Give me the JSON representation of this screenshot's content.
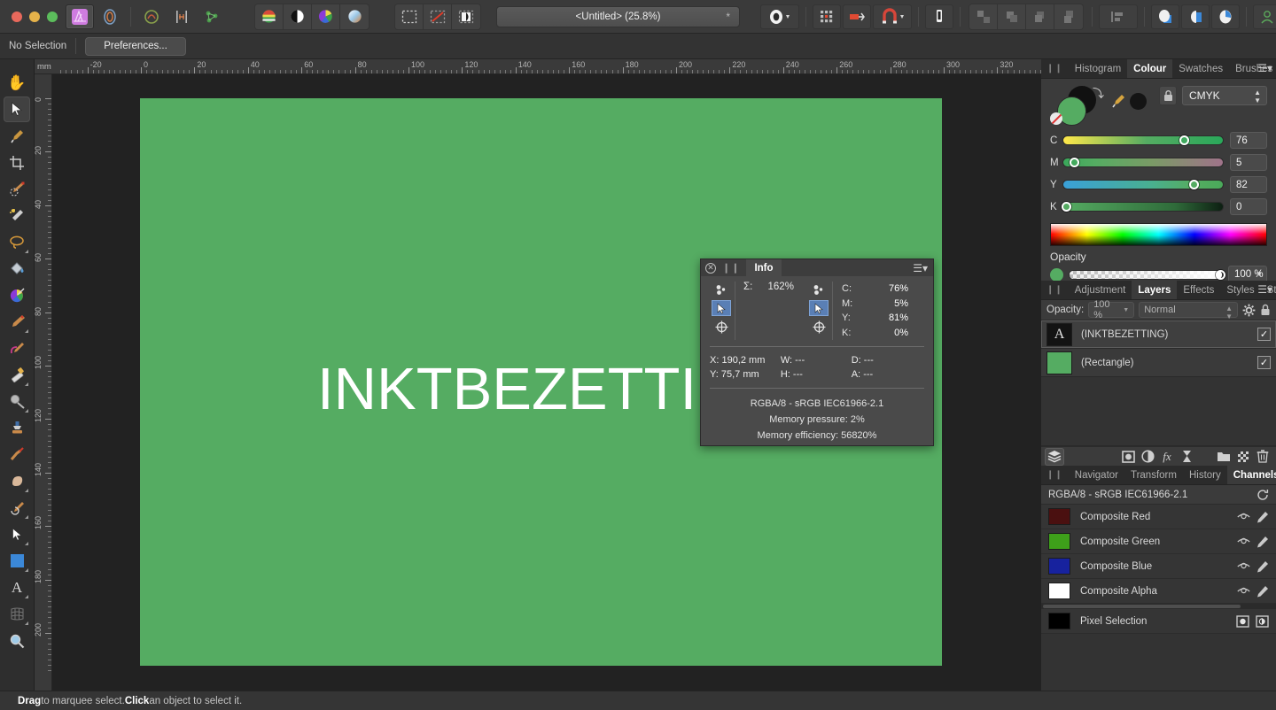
{
  "app": {
    "name": "Affinity Photo",
    "document_title": "<Untitled> (25.8%)",
    "modified_marker": "*"
  },
  "context_bar": {
    "selection_label": "No Selection",
    "preferences_label": "Preferences..."
  },
  "toolbar": {
    "window_controls": [
      "close",
      "minimize",
      "zoom"
    ],
    "persona_icons": [
      "affinity-logo-icon",
      "photo-persona-icon",
      "liquify-persona-icon",
      "develop-persona-icon",
      "tone-mapping-persona-icon",
      "export-persona-icon"
    ],
    "view_icons": [
      "colour-format-icon",
      "black-white-proof-icon",
      "colour-wheel-icon",
      "gradient-proof-icon"
    ],
    "selection_icons": [
      "marquee-select-icon",
      "deselect-icon",
      "refine-selection-icon"
    ],
    "right_icons": [
      "assistant-icon",
      "grid-icon",
      "snapping-icon",
      "magnet-icon",
      "pixel-align-icon",
      "arrange-front-icon",
      "arrange-forward-icon",
      "arrange-backward-icon",
      "arrange-back-icon",
      "align-icon",
      "blend-a-icon",
      "blend-b-icon",
      "blend-c-icon",
      "account-icon"
    ]
  },
  "tools": [
    {
      "name": "view-tool",
      "icon": "hand-icon",
      "selected": false,
      "has_flyout": false
    },
    {
      "name": "move-tool",
      "icon": "arrow-cursor-icon",
      "selected": true,
      "has_flyout": false
    },
    {
      "name": "colour-picker-tool",
      "icon": "eyedropper-icon",
      "selected": false,
      "has_flyout": false
    },
    {
      "name": "crop-tool",
      "icon": "crop-icon",
      "selected": false,
      "has_flyout": false
    },
    {
      "name": "selection-brush-tool",
      "icon": "selection-brush-icon",
      "selected": false,
      "has_flyout": false
    },
    {
      "name": "flood-select-tool",
      "icon": "magic-wand-icon",
      "selected": false,
      "has_flyout": false
    },
    {
      "name": "freehand-selection-tool",
      "icon": "lasso-icon",
      "selected": false,
      "has_flyout": true
    },
    {
      "name": "flood-fill-tool",
      "icon": "paint-bucket-icon",
      "selected": false,
      "has_flyout": false
    },
    {
      "name": "paint-mixer-tool",
      "icon": "colour-wheel-mixer-icon",
      "selected": false,
      "has_flyout": false
    },
    {
      "name": "paint-brush-tool",
      "icon": "paint-brush-icon",
      "selected": false,
      "has_flyout": true
    },
    {
      "name": "colour-replacement-tool",
      "icon": "colour-replace-brush-icon",
      "selected": false,
      "has_flyout": false
    },
    {
      "name": "erase-brush-tool",
      "icon": "eraser-icon",
      "selected": false,
      "has_flyout": true
    },
    {
      "name": "dodge-tool",
      "icon": "dodge-icon",
      "selected": false,
      "has_flyout": true
    },
    {
      "name": "clone-brush-tool",
      "icon": "clone-stamp-icon",
      "selected": false,
      "has_flyout": false
    },
    {
      "name": "blemish-removal-tool",
      "icon": "healing-brush-icon",
      "selected": false,
      "has_flyout": false
    },
    {
      "name": "smudge-tool",
      "icon": "smudge-icon",
      "selected": false,
      "has_flyout": true
    },
    {
      "name": "undo-brush-tool",
      "icon": "undo-brush-icon",
      "selected": false,
      "has_flyout": true
    },
    {
      "name": "node-tool",
      "icon": "node-pointer-icon",
      "selected": false,
      "has_flyout": true
    },
    {
      "name": "rectangle-tool",
      "icon": "rectangle-shape-icon",
      "selected": false,
      "has_flyout": true
    },
    {
      "name": "artistic-text-tool",
      "icon": "text-a-icon",
      "selected": false,
      "has_flyout": true
    },
    {
      "name": "mesh-warp-tool",
      "icon": "mesh-warp-icon",
      "selected": false,
      "has_flyout": true
    },
    {
      "name": "zoom-tool",
      "icon": "magnifier-icon",
      "selected": false,
      "has_flyout": false
    }
  ],
  "rulers": {
    "unit": "mm",
    "horizontal_ticks": [
      -20,
      0,
      20,
      40,
      60,
      80,
      100,
      120,
      140,
      160,
      180,
      200,
      220,
      240,
      260,
      280,
      300,
      320
    ],
    "vertical_ticks": [
      0,
      20,
      40,
      60,
      80,
      100,
      120,
      140,
      160,
      180,
      200
    ]
  },
  "canvas": {
    "artboard_fill": "#55ac62",
    "background": "#222222",
    "text_layer": "INKTBEZETTING",
    "text_colour": "#ffffff"
  },
  "info_panel": {
    "title": "Info",
    "sum_label": "Σ:",
    "sum_value": "162%",
    "colour_readout": [
      {
        "label": "C:",
        "value": "76%"
      },
      {
        "label": "M:",
        "value": "5%"
      },
      {
        "label": "Y:",
        "value": "81%"
      },
      {
        "label": "K:",
        "value": "0%"
      }
    ],
    "coords": [
      {
        "label": "X:",
        "value": "190,2 mm"
      },
      {
        "label": "W:",
        "value": "---"
      },
      {
        "label": "D:",
        "value": "---"
      },
      {
        "label": "Y:",
        "value": "75,7 mm"
      },
      {
        "label": "H:",
        "value": "---"
      },
      {
        "label": "A:",
        "value": "---"
      }
    ],
    "footer": [
      "RGBA/8 - sRGB IEC61966-2.1",
      "Memory pressure: 2%",
      "Memory efficiency: 56820%"
    ]
  },
  "colour_panel": {
    "tabs": [
      {
        "label": "Histogram",
        "active": false
      },
      {
        "label": "Colour",
        "active": true
      },
      {
        "label": "Swatches",
        "active": false
      },
      {
        "label": "Brushes",
        "active": false
      }
    ],
    "model": "CMYK",
    "current_colour": "#55ac62",
    "sliders": [
      {
        "channel": "C",
        "value": "76",
        "pos": 76
      },
      {
        "channel": "M",
        "value": "5",
        "pos": 5
      },
      {
        "channel": "Y",
        "value": "82",
        "pos": 82
      },
      {
        "channel": "K",
        "value": "0",
        "pos": 0
      }
    ],
    "opacity_label": "Opacity",
    "opacity_value": "100 %"
  },
  "layers_panel": {
    "tabs": [
      {
        "label": "Adjustment",
        "active": false
      },
      {
        "label": "Layers",
        "active": true
      },
      {
        "label": "Effects",
        "active": false
      },
      {
        "label": "Styles",
        "active": false
      },
      {
        "label": "Stock",
        "active": false
      }
    ],
    "opacity_label": "Opacity:",
    "opacity_value": "100 %",
    "blend_mode": "Normal",
    "layers": [
      {
        "name": "(INKTBEZETTING)",
        "thumb": "text-a-thumb",
        "visible": true,
        "selected": true
      },
      {
        "name": "(Rectangle)",
        "thumb": "green-rect-thumb",
        "visible": true,
        "selected": false
      }
    ],
    "toolbar_icons": [
      "layers-icon",
      "mask-icon",
      "adjustment-icon",
      "fx-icon",
      "live-filter-icon",
      "group-icon",
      "checker-icon",
      "trash-icon"
    ]
  },
  "channels_panel": {
    "tabs": [
      {
        "label": "Navigator",
        "active": false
      },
      {
        "label": "Transform",
        "active": false
      },
      {
        "label": "History",
        "active": false
      },
      {
        "label": "Channels",
        "active": true
      }
    ],
    "profile": "RGBA/8 - sRGB IEC61966-2.1",
    "reset_icon": "refresh-icon",
    "channels": [
      {
        "name": "Composite Red",
        "thumb": "#4a1010",
        "actions": [
          "eye-icon",
          "pencil-icon"
        ]
      },
      {
        "name": "Composite Green",
        "thumb": "#3ea01a",
        "actions": [
          "eye-icon",
          "pencil-icon"
        ]
      },
      {
        "name": "Composite Blue",
        "thumb": "#17229e",
        "actions": [
          "eye-icon",
          "pencil-icon"
        ]
      },
      {
        "name": "Composite Alpha",
        "thumb": "#ffffff",
        "actions": [
          "eye-icon",
          "pencil-icon"
        ]
      },
      {
        "name": "Pixel Selection",
        "thumb": "#000000",
        "actions": [
          "load-selection-icon",
          "invert-selection-icon"
        ]
      }
    ]
  },
  "status_bar": {
    "prefix": "Drag",
    "middle": " to marquee select. ",
    "bold2": "Click",
    "suffix": " an object to select it."
  }
}
